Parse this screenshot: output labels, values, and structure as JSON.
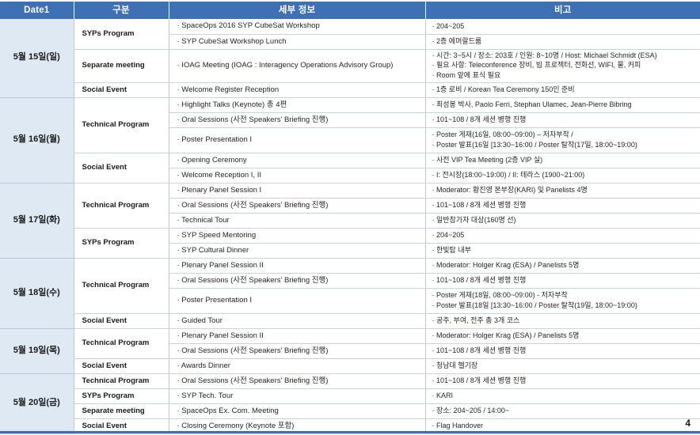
{
  "page": {
    "page_number": "4",
    "accent_color": "#3f6fb5",
    "date_cell_color": "#dfe9f4"
  },
  "table": {
    "headers": {
      "date": "Date1",
      "category": "구분",
      "detail": "세부 정보",
      "remarks": "비고"
    },
    "rows": [
      {
        "date": "5월 15일(일)",
        "category": "SYPs Program",
        "detail": "· SpaceOps 2016 SYP CubeSat Workshop",
        "remarks_lines": [
          "· 204~205"
        ]
      },
      {
        "date": "",
        "category": "",
        "detail": "· SYP CubeSat Workshop Lunch",
        "remarks_lines": [
          "· 2층 에머랄드룸"
        ]
      },
      {
        "date": "",
        "category": "Separate meeting",
        "detail": "· IOAG Meeting (IOAG : Interagency Operations Advisory Group)",
        "remarks_lines": [
          "· 시간: 3~5시 / 장소: 203호 / 인원: 8~10명 / Host: Michael Schmidt (ESA)",
          "· 필요 사항: Teleconference 장비, 빔 프로젝터, 전화선, WIFI, 물, 커피",
          "· Room 앞에 표식 필요"
        ]
      },
      {
        "date": "",
        "category": "Social Event",
        "detail": "· Welcome Register Reception",
        "remarks_lines": [
          "· 1층 로비 / Korean Tea Ceremony 150인 준비"
        ]
      },
      {
        "date": "5월 16일(월)",
        "category": "Technical Program",
        "detail": "· Highlight Talks (Keynote) 총 4편",
        "remarks_lines": [
          "· 최성봉 박사, Paolo Ferri, Stephan Ulamec, Jean-Pierre Bibring"
        ]
      },
      {
        "date": "",
        "category": "",
        "detail": "· Oral Sessions (사전 Speakers' Briefing 진행)",
        "remarks_lines": [
          "· 101~108  / 8개 세션 병행 진행"
        ]
      },
      {
        "date": "",
        "category": "",
        "detail": "· Poster Presentation I",
        "remarks_lines": [
          "· Poster 게재(16일, 08:00~09:00) – 저자부착 /",
          "· Poster 발표(16일 [13:30~16:00  /  Poster 탈착(17일, 18:00~19:00)"
        ]
      },
      {
        "date": "",
        "category": "Social Event",
        "detail": "· Opening Ceremony",
        "remarks_lines": [
          "· 사전 VIP Tea Meeting (2층 VIP 실)"
        ]
      },
      {
        "date": "",
        "category": "",
        "detail": "· Welcome Reception I, II",
        "remarks_lines": [
          "· I: 전시장(18:00~19:00) / II: 테라스 (1900~21:00)"
        ]
      },
      {
        "date": "5월 17일(화)",
        "category": "Technical Program",
        "detail": "· Plenary Panel Session I",
        "remarks_lines": [
          "· Moderator: 황진영 본부장(KARI) 및 Panelists 4명"
        ]
      },
      {
        "date": "",
        "category": "",
        "detail": "· Oral Sessions (사전 Speakers' Briefing 진행)",
        "remarks_lines": [
          "· 101~108  / 8개 세션 병행 진행"
        ]
      },
      {
        "date": "",
        "category": "",
        "detail": "· Technical Tour",
        "remarks_lines": [
          "· 일반참가자 대상(160명 선)"
        ]
      },
      {
        "date": "",
        "category": "SYPs Program",
        "detail": "· SYP Speed Mentoring",
        "remarks_lines": [
          "· 204~205"
        ]
      },
      {
        "date": "",
        "category": "",
        "detail": "· SYP Cultural Dinner",
        "remarks_lines": [
          "· 한빛탑 내부"
        ]
      },
      {
        "date": "5월 18일(수)",
        "category": "Technical Program",
        "detail": "· Plenary Panel Session II",
        "remarks_lines": [
          "· Moderator: Holger Krag (ESA) / Panelists 5명"
        ]
      },
      {
        "date": "",
        "category": "",
        "detail": "· Oral Sessions (사전 Speakers' Briefing 진행)",
        "remarks_lines": [
          "· 101~108  / 8개 세션 병행 진행"
        ]
      },
      {
        "date": "",
        "category": "",
        "detail": "· Poster Presentation I",
        "remarks_lines": [
          "· Poster 게재(18일, 08:00~09:00) - 저자부착",
          "· Poster 발표(18일 [13:30~16:00 /  Poster 탈착(19일, 18:00~19:00)"
        ]
      },
      {
        "date": "",
        "category": "Social Event",
        "detail": "· Guided Tour",
        "remarks_lines": [
          "· 공주, 부여, 전주 총 3개 코스"
        ]
      },
      {
        "date": "5월 19일(목)",
        "category": "Technical Program",
        "detail": "· Plenary Panel Session II",
        "remarks_lines": [
          "· Moderator: Holger Krag (ESA) / Panelists 5명"
        ]
      },
      {
        "date": "",
        "category": "",
        "detail": "· Oral Sessions (사전 Speakers' Briefing 진행)",
        "remarks_lines": [
          "· 101~108  / 8개 세션 병행 진행"
        ]
      },
      {
        "date": "",
        "category": "Social Event",
        "detail": "· Awards Dinner",
        "remarks_lines": [
          "· 청남대 헬기장"
        ]
      },
      {
        "date": "5월 20일(금)",
        "category": "Technical Program",
        "detail": "· Oral Sessions (사전 Speakers' Briefing 진행)",
        "remarks_lines": [
          "· 101~108  / 8개 세션 병행 진행"
        ]
      },
      {
        "date": "",
        "category": "SYPs Program",
        "detail": "· SYP Tech. Tour",
        "remarks_lines": [
          "· KARI"
        ]
      },
      {
        "date": "",
        "category": "Separate meeting",
        "detail": "· SpaceOps Ex. Com. Meeting",
        "remarks_lines": [
          "· 장소: 204~205 / 14:00~"
        ]
      },
      {
        "date": "",
        "category": "Social Event",
        "detail": "· Closing Ceremony (Keynote 포함)",
        "remarks_lines": [
          "· Flag Handover"
        ]
      }
    ],
    "date_groups": [
      {
        "label": "5월 15일(일)",
        "span": 4
      },
      {
        "label": "5월 16일(월)",
        "span": 5
      },
      {
        "label": "5월 17일(화)",
        "span": 5
      },
      {
        "label": "5월 18일(수)",
        "span": 4
      },
      {
        "label": "5월 19일(목)",
        "span": 3
      },
      {
        "label": "5월 20일(금)",
        "span": 4
      }
    ],
    "category_groups": [
      {
        "label": "SYPs Program",
        "span": 2
      },
      {
        "label": "Separate meeting",
        "span": 1
      },
      {
        "label": "Social Event",
        "span": 1
      },
      {
        "label": "Technical Program",
        "span": 3
      },
      {
        "label": "Social Event",
        "span": 2
      },
      {
        "label": "Technical Program",
        "span": 3
      },
      {
        "label": "SYPs Program",
        "span": 2
      },
      {
        "label": "Technical Program",
        "span": 3
      },
      {
        "label": "Social Event",
        "span": 1
      },
      {
        "label": "Technical Program",
        "span": 2
      },
      {
        "label": "Social Event",
        "span": 1
      },
      {
        "label": "Technical Program",
        "span": 1
      },
      {
        "label": "SYPs Program",
        "span": 1
      },
      {
        "label": "Separate meeting",
        "span": 1
      },
      {
        "label": "Social Event",
        "span": 1
      }
    ]
  }
}
